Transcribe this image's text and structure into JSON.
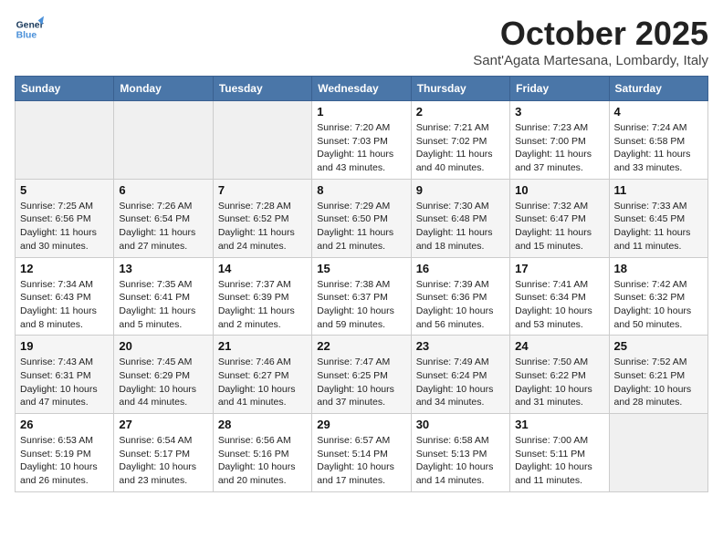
{
  "header": {
    "logo_line1": "General",
    "logo_line2": "Blue",
    "month_title": "October 2025",
    "subtitle": "Sant'Agata Martesana, Lombardy, Italy"
  },
  "weekdays": [
    "Sunday",
    "Monday",
    "Tuesday",
    "Wednesday",
    "Thursday",
    "Friday",
    "Saturday"
  ],
  "weeks": [
    [
      {
        "day": "",
        "info": ""
      },
      {
        "day": "",
        "info": ""
      },
      {
        "day": "",
        "info": ""
      },
      {
        "day": "1",
        "info": "Sunrise: 7:20 AM\nSunset: 7:03 PM\nDaylight: 11 hours\nand 43 minutes."
      },
      {
        "day": "2",
        "info": "Sunrise: 7:21 AM\nSunset: 7:02 PM\nDaylight: 11 hours\nand 40 minutes."
      },
      {
        "day": "3",
        "info": "Sunrise: 7:23 AM\nSunset: 7:00 PM\nDaylight: 11 hours\nand 37 minutes."
      },
      {
        "day": "4",
        "info": "Sunrise: 7:24 AM\nSunset: 6:58 PM\nDaylight: 11 hours\nand 33 minutes."
      }
    ],
    [
      {
        "day": "5",
        "info": "Sunrise: 7:25 AM\nSunset: 6:56 PM\nDaylight: 11 hours\nand 30 minutes."
      },
      {
        "day": "6",
        "info": "Sunrise: 7:26 AM\nSunset: 6:54 PM\nDaylight: 11 hours\nand 27 minutes."
      },
      {
        "day": "7",
        "info": "Sunrise: 7:28 AM\nSunset: 6:52 PM\nDaylight: 11 hours\nand 24 minutes."
      },
      {
        "day": "8",
        "info": "Sunrise: 7:29 AM\nSunset: 6:50 PM\nDaylight: 11 hours\nand 21 minutes."
      },
      {
        "day": "9",
        "info": "Sunrise: 7:30 AM\nSunset: 6:48 PM\nDaylight: 11 hours\nand 18 minutes."
      },
      {
        "day": "10",
        "info": "Sunrise: 7:32 AM\nSunset: 6:47 PM\nDaylight: 11 hours\nand 15 minutes."
      },
      {
        "day": "11",
        "info": "Sunrise: 7:33 AM\nSunset: 6:45 PM\nDaylight: 11 hours\nand 11 minutes."
      }
    ],
    [
      {
        "day": "12",
        "info": "Sunrise: 7:34 AM\nSunset: 6:43 PM\nDaylight: 11 hours\nand 8 minutes."
      },
      {
        "day": "13",
        "info": "Sunrise: 7:35 AM\nSunset: 6:41 PM\nDaylight: 11 hours\nand 5 minutes."
      },
      {
        "day": "14",
        "info": "Sunrise: 7:37 AM\nSunset: 6:39 PM\nDaylight: 11 hours\nand 2 minutes."
      },
      {
        "day": "15",
        "info": "Sunrise: 7:38 AM\nSunset: 6:37 PM\nDaylight: 10 hours\nand 59 minutes."
      },
      {
        "day": "16",
        "info": "Sunrise: 7:39 AM\nSunset: 6:36 PM\nDaylight: 10 hours\nand 56 minutes."
      },
      {
        "day": "17",
        "info": "Sunrise: 7:41 AM\nSunset: 6:34 PM\nDaylight: 10 hours\nand 53 minutes."
      },
      {
        "day": "18",
        "info": "Sunrise: 7:42 AM\nSunset: 6:32 PM\nDaylight: 10 hours\nand 50 minutes."
      }
    ],
    [
      {
        "day": "19",
        "info": "Sunrise: 7:43 AM\nSunset: 6:31 PM\nDaylight: 10 hours\nand 47 minutes."
      },
      {
        "day": "20",
        "info": "Sunrise: 7:45 AM\nSunset: 6:29 PM\nDaylight: 10 hours\nand 44 minutes."
      },
      {
        "day": "21",
        "info": "Sunrise: 7:46 AM\nSunset: 6:27 PM\nDaylight: 10 hours\nand 41 minutes."
      },
      {
        "day": "22",
        "info": "Sunrise: 7:47 AM\nSunset: 6:25 PM\nDaylight: 10 hours\nand 37 minutes."
      },
      {
        "day": "23",
        "info": "Sunrise: 7:49 AM\nSunset: 6:24 PM\nDaylight: 10 hours\nand 34 minutes."
      },
      {
        "day": "24",
        "info": "Sunrise: 7:50 AM\nSunset: 6:22 PM\nDaylight: 10 hours\nand 31 minutes."
      },
      {
        "day": "25",
        "info": "Sunrise: 7:52 AM\nSunset: 6:21 PM\nDaylight: 10 hours\nand 28 minutes."
      }
    ],
    [
      {
        "day": "26",
        "info": "Sunrise: 6:53 AM\nSunset: 5:19 PM\nDaylight: 10 hours\nand 26 minutes."
      },
      {
        "day": "27",
        "info": "Sunrise: 6:54 AM\nSunset: 5:17 PM\nDaylight: 10 hours\nand 23 minutes."
      },
      {
        "day": "28",
        "info": "Sunrise: 6:56 AM\nSunset: 5:16 PM\nDaylight: 10 hours\nand 20 minutes."
      },
      {
        "day": "29",
        "info": "Sunrise: 6:57 AM\nSunset: 5:14 PM\nDaylight: 10 hours\nand 17 minutes."
      },
      {
        "day": "30",
        "info": "Sunrise: 6:58 AM\nSunset: 5:13 PM\nDaylight: 10 hours\nand 14 minutes."
      },
      {
        "day": "31",
        "info": "Sunrise: 7:00 AM\nSunset: 5:11 PM\nDaylight: 10 hours\nand 11 minutes."
      },
      {
        "day": "",
        "info": ""
      }
    ]
  ]
}
